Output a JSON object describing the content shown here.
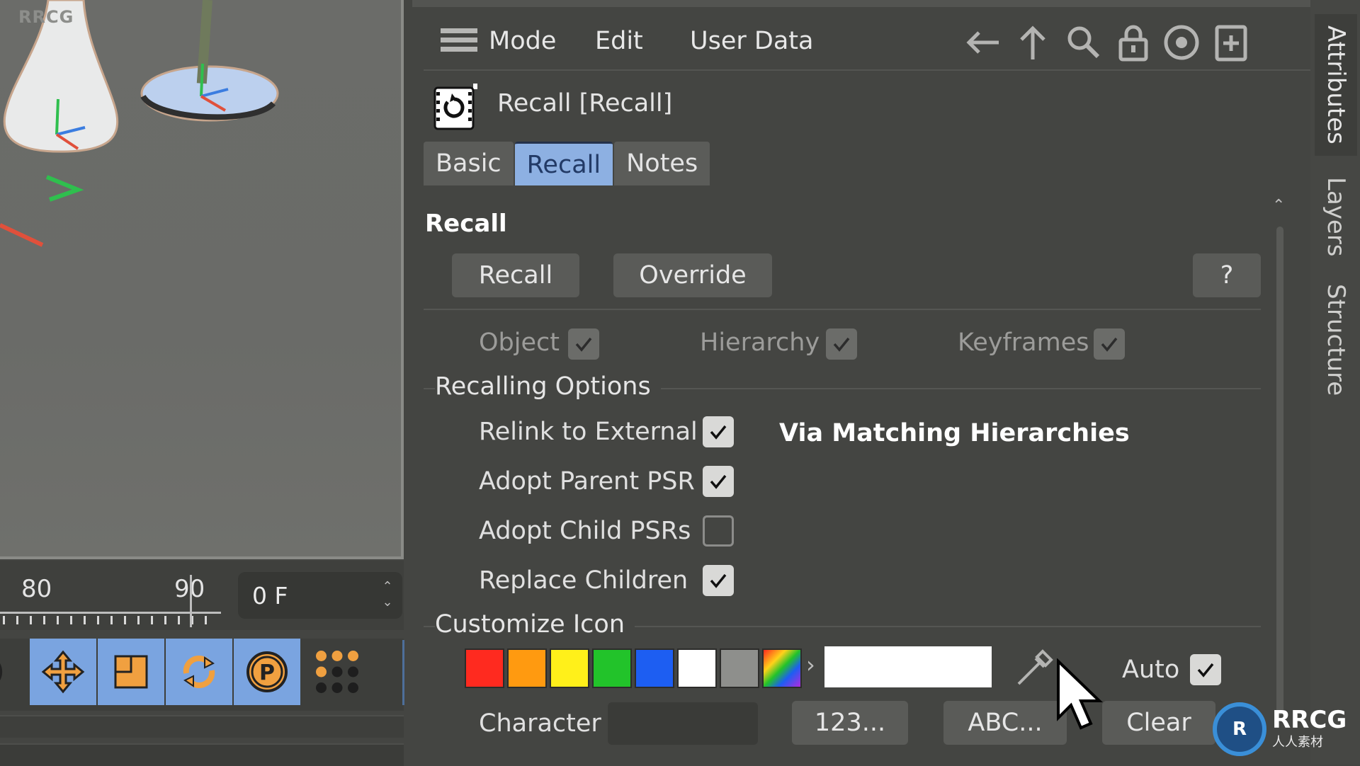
{
  "viewport": {
    "watermark_label": "RRCG",
    "timeline": {
      "tick_labels": [
        "80",
        "90"
      ],
      "current_frame": "0 F"
    },
    "tools": [
      {
        "name": "move",
        "active": true
      },
      {
        "name": "scale",
        "active": true
      },
      {
        "name": "rotate",
        "active": true
      },
      {
        "name": "parameter",
        "active": true
      },
      {
        "name": "dots-grid",
        "active": false
      }
    ]
  },
  "attribute_manager": {
    "menu": [
      "Mode",
      "Edit",
      "User Data"
    ],
    "toolbar_icons": [
      "back-arrow",
      "up-arrow",
      "search",
      "lock",
      "target",
      "new-panel"
    ],
    "object_title": "Recall [Recall]",
    "tabs": [
      {
        "label": "Basic",
        "active": false
      },
      {
        "label": "Recall",
        "active": true
      },
      {
        "label": "Notes",
        "active": false
      }
    ],
    "recall_section": {
      "title": "Recall",
      "buttons": {
        "recall": "Recall",
        "override": "Override",
        "help": "?"
      },
      "flags": [
        {
          "label": "Object",
          "checked": true,
          "enabled": false
        },
        {
          "label": "Hierarchy",
          "checked": true,
          "enabled": false
        },
        {
          "label": "Keyframes",
          "checked": true,
          "enabled": false
        }
      ]
    },
    "recalling_options": {
      "title": "Recalling Options",
      "options": [
        {
          "label": "Relink to External",
          "checked": true
        },
        {
          "label": "Adopt Parent PSR",
          "checked": true
        },
        {
          "label": "Adopt Child PSRs",
          "checked": false
        },
        {
          "label": "Replace Children",
          "checked": true
        }
      ],
      "relink_mode": "Via Matching Hierarchies"
    },
    "customize_icon": {
      "title": "Customize Icon",
      "swatches": [
        "#ff2a1f",
        "#ff9a10",
        "#fff01a",
        "#22c32a",
        "#1d5ef2",
        "#ffffff",
        "#8e8f8c",
        "rainbow"
      ],
      "color_value": "#ffffff",
      "auto_label": "Auto",
      "auto_checked": true,
      "character_label": "Character",
      "character_value": "",
      "buttons": {
        "numeric": "123...",
        "alpha": "ABC...",
        "clear": "Clear"
      }
    }
  },
  "side_tabs": [
    {
      "label": "Attributes",
      "active": true
    },
    {
      "label": "Layers",
      "active": false
    },
    {
      "label": "Structure",
      "active": false
    }
  ],
  "watermark": {
    "title": "RRCG",
    "subtitle": "人人素材"
  }
}
